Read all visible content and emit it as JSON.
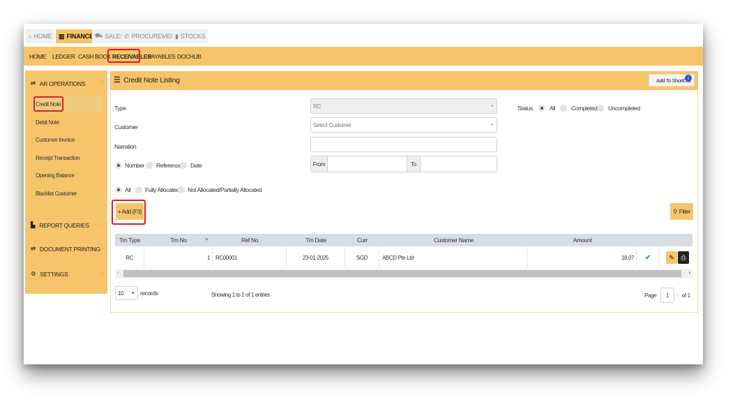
{
  "module_tabs": [
    {
      "label": "HOME",
      "icon": "home-icon"
    },
    {
      "label": "FINANCE",
      "icon": "bank-icon"
    },
    {
      "label": "SALES",
      "icon": "cart-icon"
    },
    {
      "label": "PROCUREMENT",
      "icon": "megaphone-icon"
    },
    {
      "label": "STOCKS",
      "icon": "bar-chart-icon"
    }
  ],
  "subnav": [
    "HOME",
    "LEDGER",
    "CASH BOOK",
    "RECEIVABLES",
    "PAYABLES",
    "DOCHUB"
  ],
  "sidebar": {
    "section": "AR OPERATIONS",
    "items": [
      "Credit Note",
      "Debit Note",
      "Customer Invoice",
      "Receipt Transaction",
      "Opening Balance",
      "Blacklist Customer"
    ],
    "report": "REPORT QUERIES",
    "printing": "DOCUMENT PRINTING",
    "settings": "SETTINGS"
  },
  "panel": {
    "title": "Credit Note Listing",
    "shortcut": "Add To ShortCut",
    "shortcut_badge": "i"
  },
  "form": {
    "type_label": "Type",
    "type_value": "RC",
    "customer_label": "Customer",
    "customer_placeholder": "Select Customer",
    "narration_label": "Narration",
    "sort_options": [
      "Number",
      "Reference",
      "Date"
    ],
    "from_label": "From",
    "to_label": "To",
    "status_label": "Status",
    "status_options": [
      "All",
      "Completed",
      "Uncompleted"
    ],
    "alloc_options": [
      "All",
      "Fully Allocated",
      "Not Allocated/Partially Allocated"
    ],
    "add_label": "+ Add (F3)",
    "filter_label": "Filter"
  },
  "table": {
    "headers": [
      "Trn Type",
      "Trn No",
      "Ref No",
      "Trn Date",
      "Curr",
      "Customer Name",
      "Amount"
    ],
    "row": {
      "type": "RC",
      "no": "1",
      "ref": "RC00001",
      "date": "23-01-2025",
      "curr": "SGD",
      "customer": "ABCD Pte Ltd",
      "amount": "18.07"
    }
  },
  "footer": {
    "page_size": "10",
    "records_label": "records",
    "showing": "Showing 1 to 1 of 1 entries",
    "page_label": "Page",
    "page_num": "1",
    "of_label": "of 1"
  },
  "colors": {
    "accent": "#f6c46a",
    "highlight": "#d3202a",
    "check": "#3aa13a"
  }
}
